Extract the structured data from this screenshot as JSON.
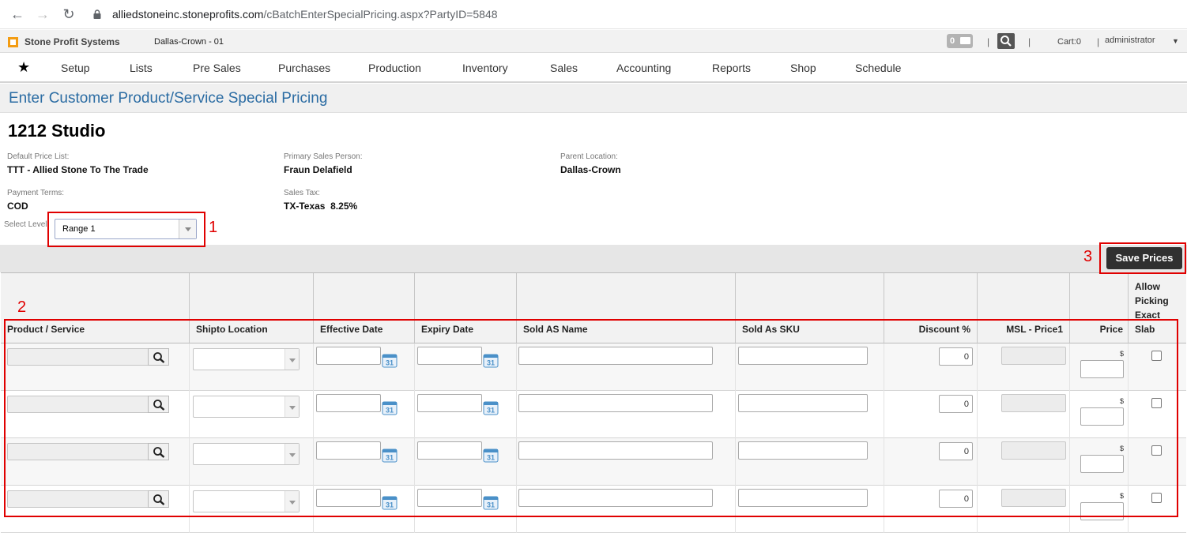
{
  "browser": {
    "url_host": "alliedstoneinc.stoneprofits.com",
    "url_path": "/cBatchEnterSpecialPricing.aspx?PartyID=5848"
  },
  "header": {
    "app_name": "Stone Profit Systems",
    "location": "Dallas-Crown - 01",
    "message_count": "0",
    "cart": "Cart:0",
    "user": "administrator"
  },
  "menu": [
    "Setup",
    "Lists",
    "Pre Sales",
    "Purchases",
    "Production",
    "Inventory",
    "Sales",
    "Accounting",
    "Reports",
    "Shop",
    "Schedule"
  ],
  "page": {
    "title": "Enter Customer Product/Service Special Pricing",
    "customer_name": "1212 Studio"
  },
  "info": {
    "default_price_list_label": "Default Price List:",
    "default_price_list": "TTT - Allied Stone To The Trade",
    "primary_sales_person_label": "Primary Sales Person:",
    "primary_sales_person": "Fraun Delafield",
    "parent_location_label": "Parent Location:",
    "parent_location": "Dallas-Crown",
    "payment_terms_label": "Payment Terms:",
    "payment_terms": "COD",
    "sales_tax_label": "Sales Tax:",
    "sales_tax": "TX-Texas  8.25%"
  },
  "level": {
    "label": "Select Level",
    "value": "Range 1"
  },
  "actions": {
    "save_label": "Save Prices"
  },
  "columns": {
    "product": "Product / Service",
    "shipto": "Shipto Location",
    "effective": "Effective Date",
    "expiry": "Expiry Date",
    "sold_as_name": "Sold AS Name",
    "sold_as_sku": "Sold As SKU",
    "discount": "Discount %",
    "msl": "MSL - Price1",
    "price": "Price",
    "allow_line1": "Allow",
    "allow_line2": "Picking",
    "allow_line3": "Exact",
    "allow_line4": "Slab"
  },
  "rows": [
    {
      "discount": "0",
      "currency": "$"
    },
    {
      "discount": "0",
      "currency": "$"
    },
    {
      "discount": "0",
      "currency": "$"
    },
    {
      "discount": "0",
      "currency": "$"
    }
  ],
  "annotations": [
    "1",
    "2",
    "3"
  ],
  "icons": {
    "back": "arrow-left-icon",
    "forward": "arrow-right-icon",
    "reload": "reload-icon",
    "lock": "lock-icon",
    "search": "magnifier-icon",
    "calendar": "calendar-icon",
    "favorites": "star-icon"
  },
  "colors": {
    "title_blue": "#2b6ca3",
    "annotation_red": "#e00000",
    "save_button": "#303030"
  }
}
